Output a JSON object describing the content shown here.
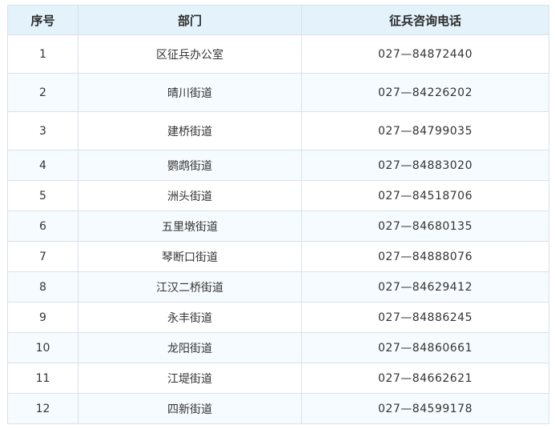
{
  "table": {
    "headers": [
      "序号",
      "部门",
      "征兵咨询电话"
    ],
    "rows": [
      {
        "no": "1",
        "dept": "区征兵办公室",
        "phone": "027—84872440"
      },
      {
        "no": "2",
        "dept": "晴川街道",
        "phone": "027—84226202"
      },
      {
        "no": "3",
        "dept": "建桥街道",
        "phone": "027—84799035"
      },
      {
        "no": "4",
        "dept": "鹦鹉街道",
        "phone": "027—84883020"
      },
      {
        "no": "5",
        "dept": "洲头街道",
        "phone": "027—84518706"
      },
      {
        "no": "6",
        "dept": "五里墩街道",
        "phone": "027—84680135"
      },
      {
        "no": "7",
        "dept": "琴断口街道",
        "phone": "027—84888076"
      },
      {
        "no": "8",
        "dept": "江汉二桥街道",
        "phone": "027—84629412"
      },
      {
        "no": "9",
        "dept": "永丰街道",
        "phone": "027—84886245"
      },
      {
        "no": "10",
        "dept": "龙阳街道",
        "phone": "027—84860661"
      },
      {
        "no": "11",
        "dept": "江堤街道",
        "phone": "027—84662621"
      },
      {
        "no": "12",
        "dept": "四新街道",
        "phone": "027—84599178"
      }
    ]
  }
}
